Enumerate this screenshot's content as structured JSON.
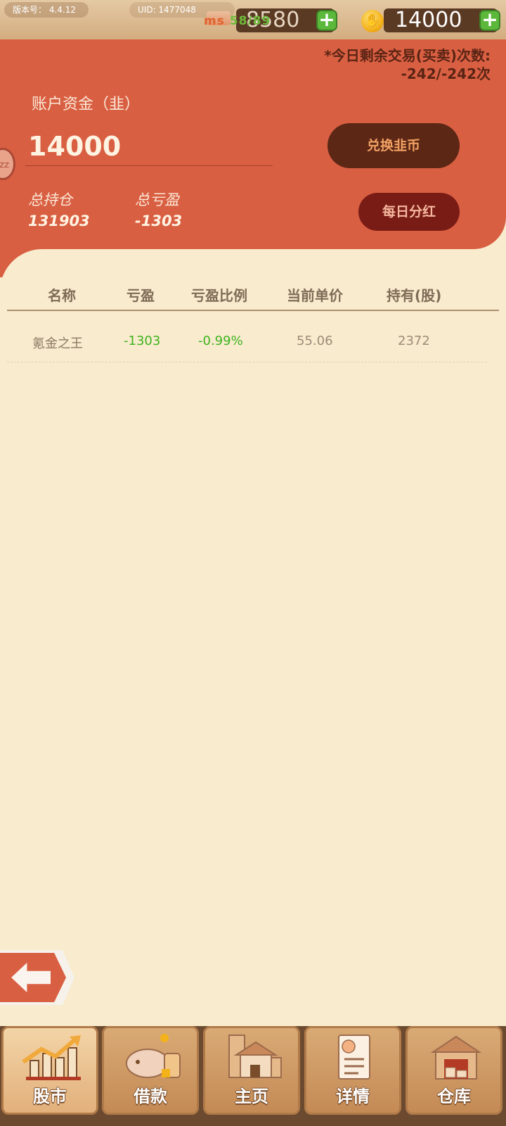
{
  "topbar": {
    "version": "版本号： 4.4.12",
    "uid": "UID: 1477048",
    "resource1_value": "8580",
    "fps_overlay": "ms",
    "fps_value": "58/89",
    "gold_value": "14000",
    "plus": "+"
  },
  "account": {
    "trades_label": "*今日剩余交易(买卖)次数:",
    "trades_value": "-242/-242次",
    "capital_label": "账户资金（韭）",
    "capital_value": "14000",
    "exchange_button": "兑换韭币",
    "total_position_label": "总持仓",
    "total_position_value": "131903",
    "total_pnl_label": "总亏盈",
    "total_pnl_value": "-1303",
    "dividend_button": "每日分红",
    "side_knob": "ZZ"
  },
  "table": {
    "headers": [
      "名称",
      "亏盈",
      "亏盈比例",
      "当前单价",
      "持有(股)"
    ],
    "rows": [
      {
        "name": "氪金之王",
        "pnl": "-1303",
        "pnl_ratio": "-0.99%",
        "price": "55.06",
        "holding": "2372"
      }
    ]
  },
  "colors": {
    "panel": "#d95f42",
    "background": "#f9ebcd",
    "profit_green": "#3db31f",
    "dark_button": "#5c2715"
  },
  "nav": {
    "tabs": [
      {
        "label": "股市",
        "icon": "stock-chart-icon"
      },
      {
        "label": "借款",
        "icon": "piggy-bank-icon"
      },
      {
        "label": "主页",
        "icon": "home-icon"
      },
      {
        "label": "详情",
        "icon": "profile-card-icon"
      },
      {
        "label": "仓库",
        "icon": "warehouse-icon"
      }
    ]
  }
}
